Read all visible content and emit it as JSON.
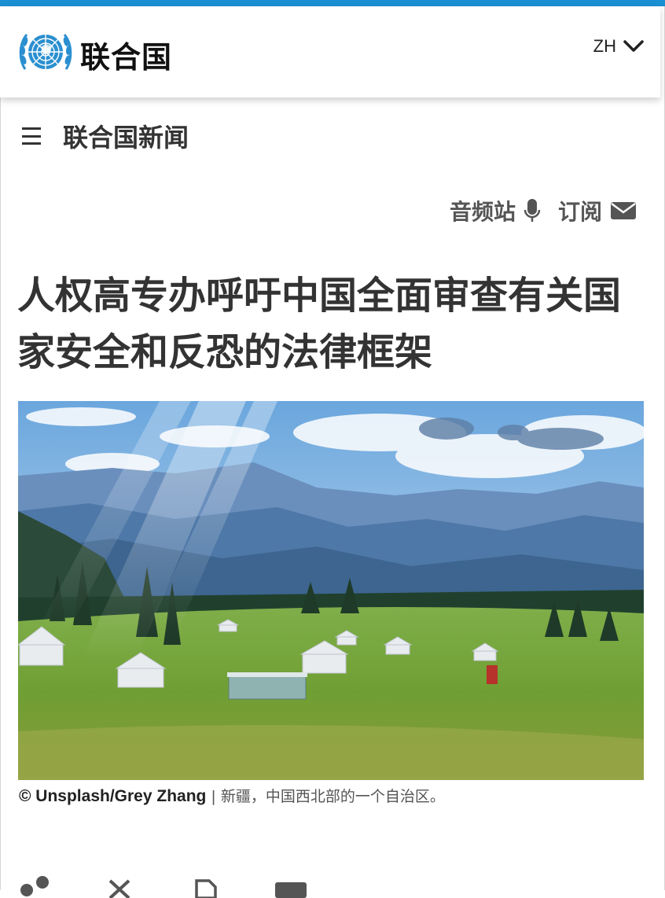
{
  "header": {
    "brand": "联合国",
    "language": "ZH",
    "accent_color": "#1a8fd1"
  },
  "nav": {
    "section_title": "联合国新闻",
    "menu_icon": "hamburger-icon"
  },
  "utility": {
    "audio_label": "音频站",
    "audio_icon": "microphone-icon",
    "subscribe_label": "订阅",
    "subscribe_icon": "envelope-icon"
  },
  "article": {
    "headline": "人权高专办呼吁中国全面审查有关国家安全和反恐的法律框架",
    "image_alt": "新疆草原上的蒙古包与远山",
    "caption_credit": "© Unsplash/Grey Zhang",
    "caption_text": " | 新疆，中国西北部的一个自治区。"
  },
  "share": {
    "icons": [
      "share-icon",
      "x-icon",
      "document-icon",
      "email-icon"
    ]
  }
}
